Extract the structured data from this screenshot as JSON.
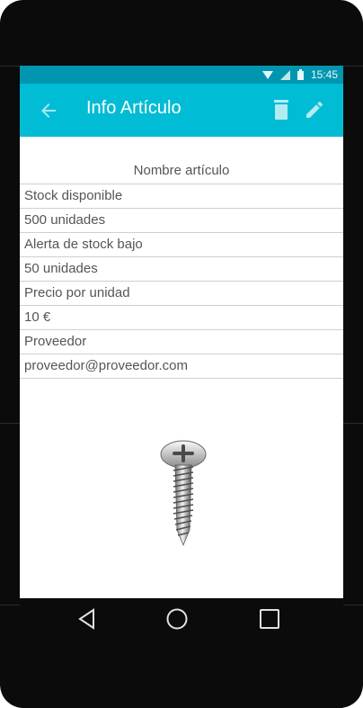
{
  "status_bar": {
    "time": "15:45"
  },
  "app_bar": {
    "title": "Info Artículo"
  },
  "item": {
    "header": "Nombre artículo",
    "rows": [
      "Stock disponible",
      "500 unidades",
      "Alerta de stock bajo",
      "50 unidades",
      "Precio por unidad",
      "10 €",
      "Proveedor",
      "proveedor@proveedor.com"
    ]
  },
  "colors": {
    "status_bar": "#0096b0",
    "app_bar": "#00bcd4",
    "screen_bg": "#ffffff",
    "device_frame": "#0b0b0b",
    "text": "#555555",
    "divider": "#cfcfcf"
  },
  "icons": {
    "back": "arrow-back-icon",
    "delete": "trash-icon",
    "edit": "pencil-icon",
    "nav_back": "triangle-back-icon",
    "nav_home": "circle-home-icon",
    "nav_recents": "square-recents-icon"
  }
}
